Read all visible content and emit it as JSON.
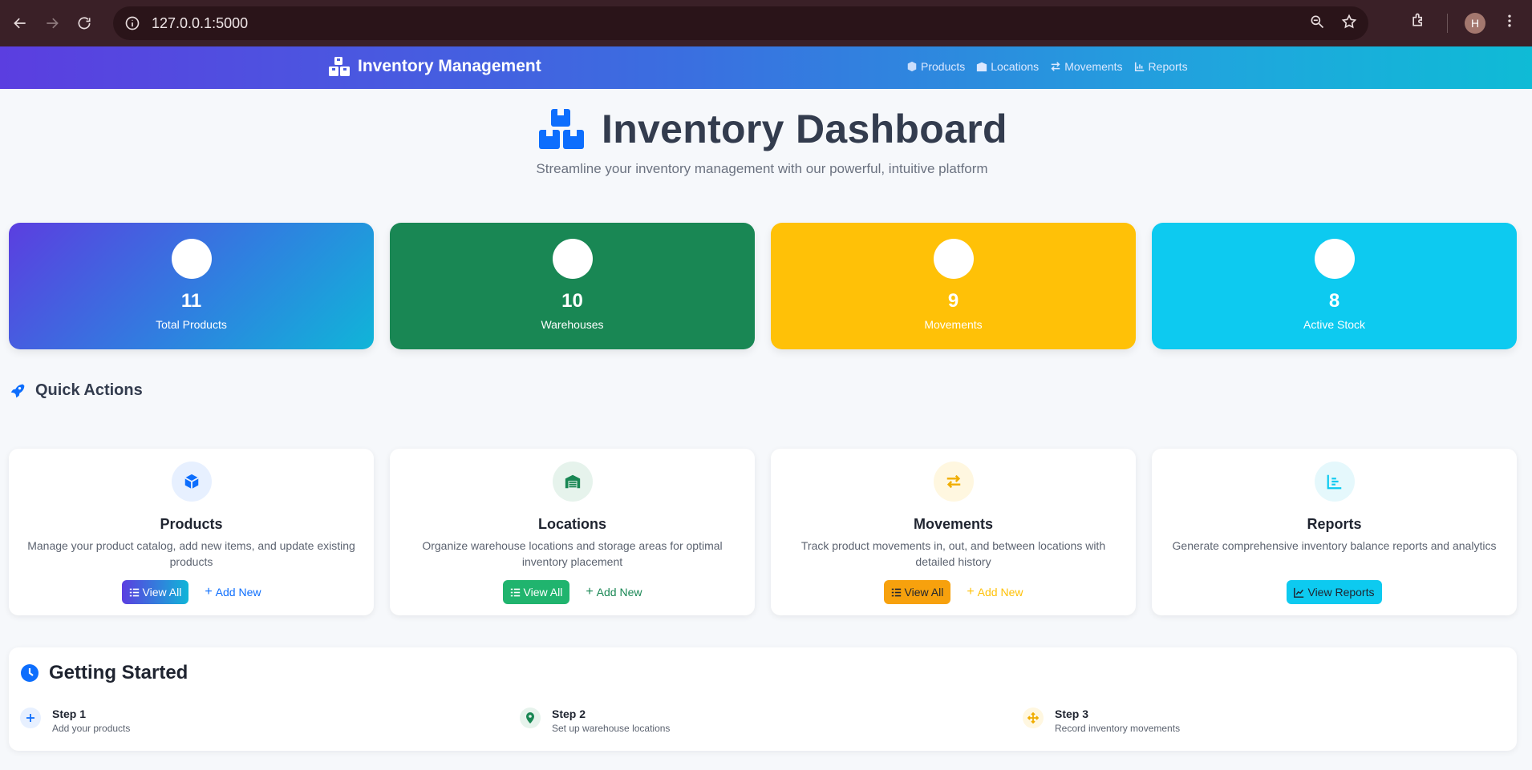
{
  "browser": {
    "url": "127.0.0.1:5000",
    "profile_initial": "H"
  },
  "navbar": {
    "brand": "Inventory Management",
    "links": [
      {
        "label": "Products",
        "icon": "box-icon"
      },
      {
        "label": "Locations",
        "icon": "warehouse-icon"
      },
      {
        "label": "Movements",
        "icon": "exchange-icon"
      },
      {
        "label": "Reports",
        "icon": "chart-icon"
      }
    ]
  },
  "hero": {
    "title": "Inventory Dashboard",
    "subtitle": "Streamline your inventory management with our powerful, intuitive platform"
  },
  "stats": [
    {
      "value": "11",
      "label": "Total Products",
      "color": "#5b3ee0"
    },
    {
      "value": "10",
      "label": "Warehouses",
      "color": "#198754"
    },
    {
      "value": "9",
      "label": "Movements",
      "color": "#ffc107"
    },
    {
      "value": "8",
      "label": "Active Stock",
      "color": "#0dcaf0"
    }
  ],
  "quick_actions": {
    "heading": "Quick Actions",
    "cards": [
      {
        "title": "Products",
        "description": "Manage your product catalog, add new items, and update existing products",
        "view_label": "View All",
        "add_label": "Add New",
        "accent": "#0d6efd"
      },
      {
        "title": "Locations",
        "description": "Organize warehouse locations and storage areas for optimal inventory placement",
        "view_label": "View All",
        "add_label": "Add New",
        "accent": "#198754"
      },
      {
        "title": "Movements",
        "description": "Track product movements in, out, and between locations with detailed history",
        "view_label": "View All",
        "add_label": "Add New",
        "accent": "#ffc107"
      },
      {
        "title": "Reports",
        "description": "Generate comprehensive inventory balance reports and analytics",
        "view_label": "View Reports",
        "accent": "#0dcaf0"
      }
    ]
  },
  "getting_started": {
    "title": "Getting Started",
    "steps": [
      {
        "title": "Step 1",
        "description": "Add your products"
      },
      {
        "title": "Step 2",
        "description": "Set up warehouse locations"
      },
      {
        "title": "Step 3",
        "description": "Record inventory movements"
      }
    ]
  }
}
